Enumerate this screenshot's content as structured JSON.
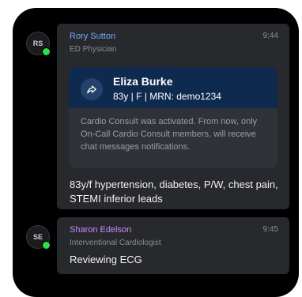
{
  "messages": [
    {
      "initials": "RS",
      "sender": "Rory Sutton",
      "sender_color": "#6fa8ff",
      "role": "ED Physician",
      "time": "9:44",
      "card": {
        "icon": "share-arrow-icon",
        "patient_name": "Eliza Burke",
        "patient_meta": "83y  |  F  |  MRN: demo1234",
        "notice": "Cardio Consult was activated. From now, only On-Call Cardio Consult members, will receive chat messages notifications."
      },
      "text": "83y/f hypertension, diabetes, P/W, chest pain, STEMI inferior leads"
    },
    {
      "initials": "SE",
      "sender": "Sharon Edelson",
      "sender_color": "#c08cff",
      "role": "Interventional Cardiologist",
      "time": "9:45",
      "text": "Reviewing ECG"
    }
  ],
  "colors": {
    "presence": "#2ee04d",
    "card_header": "#0f2a4f",
    "bubble": "#28292c"
  }
}
